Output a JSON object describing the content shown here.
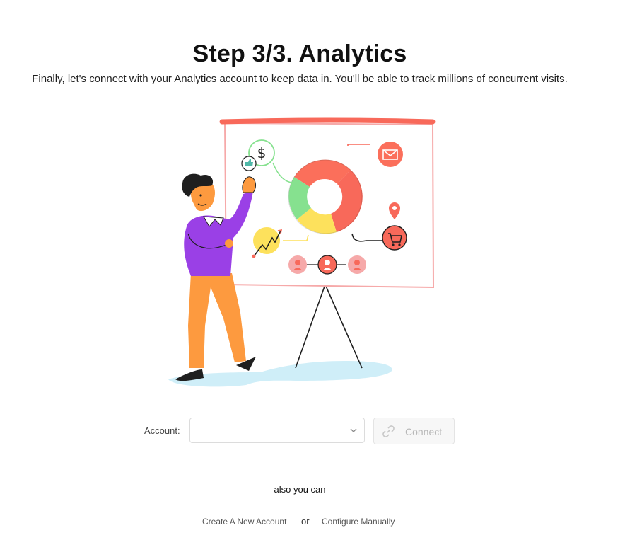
{
  "header": {
    "title": "Step 3/3. Analytics",
    "subtitle": "Finally, let's connect with your Analytics account to keep data in. You'll be able to track millions of concurrent visits."
  },
  "illustration": {
    "icons": [
      "dollar-icon",
      "thumbs-up-icon",
      "mail-icon",
      "location-pin-icon",
      "shopping-cart-icon",
      "trend-up-icon",
      "user-icon"
    ],
    "donut_colors": [
      "#fb6f5b",
      "#f8695a",
      "#fde15c",
      "#86e18f"
    ]
  },
  "account": {
    "label": "Account:",
    "selected": "",
    "connect_label": "Connect"
  },
  "alternatives": {
    "intro": "also you can",
    "create_label": "Create A New Account",
    "or_label": "or",
    "manual_label": "Configure Manually"
  },
  "colors": {
    "accent_coral": "#fb6f5b",
    "disabled_text": "#b8b8b8"
  }
}
